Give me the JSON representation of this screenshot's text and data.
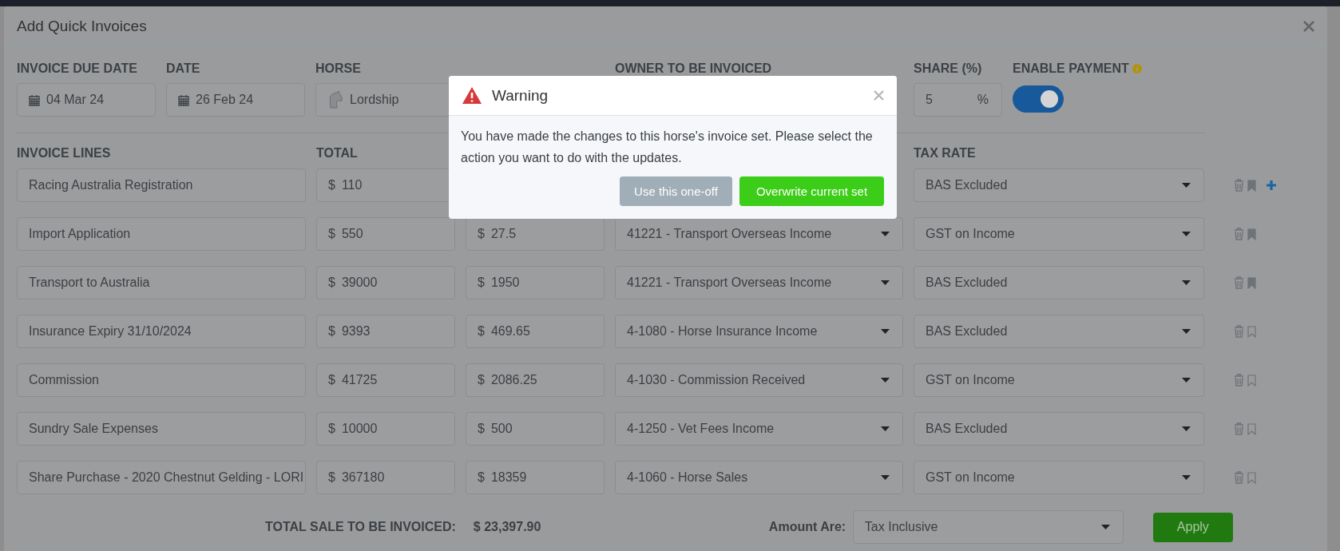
{
  "modal": {
    "title": "Add Quick Invoices"
  },
  "header_fields": [
    {
      "kind": "date",
      "label": "INVOICE DUE DATE",
      "value": "04 Mar 24"
    },
    {
      "kind": "date",
      "label": "DATE",
      "value": "26 Feb 24"
    },
    {
      "kind": "horse",
      "label": "HORSE",
      "value": "Lordship"
    },
    {
      "kind": "select",
      "label": "OWNER TO BE INVOICED"
    },
    {
      "kind": "percent",
      "label": "SHARE (%)",
      "value": "5",
      "suffix": "%"
    },
    {
      "kind": "toggle",
      "label": "ENABLE PAYMENT",
      "on": true
    }
  ],
  "lines": {
    "columns": [
      "INVOICE LINES",
      "TOTAL",
      null,
      null,
      "TAX RATE"
    ],
    "rows": [
      {
        "description": "Racing Australia Registration",
        "total_currency": "$",
        "total": "110",
        "tax_rate": "BAS Excluded",
        "bookmarked": true,
        "add": true
      },
      {
        "description": "Import Application",
        "total_currency": "$",
        "total": "550",
        "tax_currency": "$",
        "tax": "27.5",
        "account": "41221 - Transport Overseas Income",
        "tax_rate": "GST on Income",
        "bookmarked": true,
        "add": false
      },
      {
        "description": "Transport to Australia",
        "total_currency": "$",
        "total": "39000",
        "tax_currency": "$",
        "tax": "1950",
        "account": "41221 - Transport Overseas Income",
        "tax_rate": "BAS Excluded",
        "bookmarked": true,
        "add": false
      },
      {
        "description": "Insurance Expiry 31/10/2024",
        "total_currency": "$",
        "total": "9393",
        "tax_currency": "$",
        "tax": "469.65",
        "account": "4-1080 - Horse Insurance Income",
        "tax_rate": "BAS Excluded",
        "bookmarked": false,
        "add": false
      },
      {
        "description": "Commission",
        "total_currency": "$",
        "total": "41725",
        "tax_currency": "$",
        "tax": "2086.25",
        "account": "4-1030 - Commission Received",
        "tax_rate": "GST on Income",
        "bookmarked": false,
        "add": false
      },
      {
        "description": "Sundry Sale Expenses",
        "total_currency": "$",
        "total": "10000",
        "tax_currency": "$",
        "tax": "500",
        "account": "4-1250 - Vet Fees Income",
        "tax_rate": "BAS Excluded",
        "bookmarked": false,
        "add": false
      },
      {
        "description": "Share Purchase -  2020 Chestnut Gelding - LORI",
        "total_currency": "$",
        "total": "367180",
        "tax_currency": "$",
        "tax": "18359",
        "account": "4-1060 - Horse Sales",
        "tax_rate": "GST on Income",
        "bookmarked": false,
        "add": false
      }
    ]
  },
  "footer": {
    "total_label": "TOTAL SALE TO BE INVOICED:",
    "total_value": "$ 23,397.90",
    "amount_label": "Amount Are:",
    "amount_value": "Tax Inclusive",
    "apply": "Apply"
  },
  "dialog": {
    "title": "Warning",
    "message": "You have made the changes to this horse's invoice set. Please select the action you want to do with the updates.",
    "buttons": [
      {
        "kind": "secondary",
        "label": "Use this one-off"
      },
      {
        "kind": "primary",
        "label": "Overwrite current set"
      }
    ]
  }
}
